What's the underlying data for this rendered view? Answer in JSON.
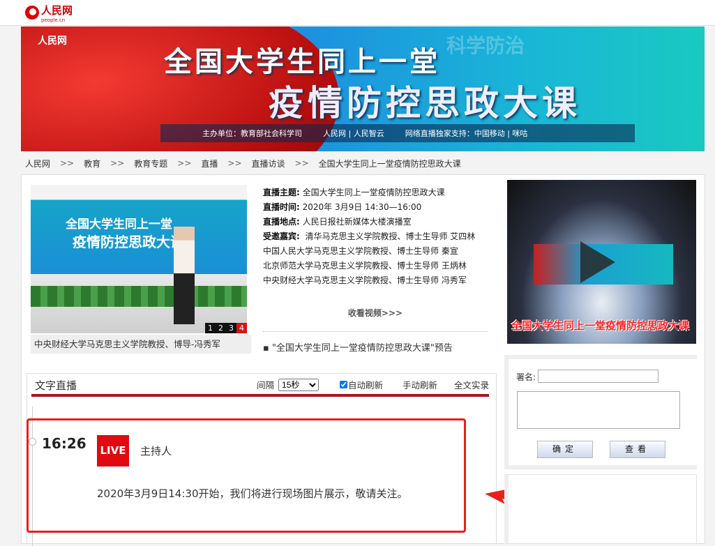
{
  "site": {
    "logo_text": "人民网",
    "logo_sub": "people.cn"
  },
  "banner": {
    "line1": "全国大学生同上一堂",
    "line2": "疫情防控思政大课",
    "bg_text": "科学防治",
    "sponsor": "主办单位：教育部社会科学司",
    "sponsor_logos": "人民网 | 人民智云",
    "support": "网络直播独家支持：中国移动 | 咪咕"
  },
  "breadcrumb": [
    "人民网",
    "教育",
    "教育专题",
    "直播",
    "直播访谈",
    "全国大学生同上一堂疫情防控思政大课"
  ],
  "breadcrumb_sep": ">>",
  "photo": {
    "title1": "全国大学生同上一堂",
    "title2": "疫情防控思政大课",
    "pages": [
      "1",
      "2",
      "3",
      "4"
    ],
    "active_page": 4,
    "caption": "中央财经大学马克思主义学院教授、博导-冯秀军"
  },
  "info": {
    "topic_label": "直播主题:",
    "topic": "全国大学生同上一堂疫情防控思政大课",
    "time_label": "直播时间:",
    "time": "2020年 3月9日 14:30—16:00",
    "place_label": "直播地点:",
    "place": "人民日报社新媒体大楼演播室",
    "guests_label": "受邀嘉宾:",
    "guests": [
      "清华马克思主义学院教授、博士生导师 艾四林",
      "中国人民大学马克思主义学院教授、博士生导师 秦宣",
      "北京师范大学马克思主义学院教授、博士生导师 王炳林",
      "中央财经大学马克思主义学院教授、博士生导师 冯秀军"
    ],
    "watch": "收看视频>>>",
    "preview": "\"全国大学生同上一堂疫情防控思政大课\"预告"
  },
  "video": {
    "overlay_title": "全国大学生同上一堂疫情防控思政大课"
  },
  "live": {
    "title": "文字直播",
    "interval_label": "间隔",
    "interval": "15秒",
    "auto_refresh": "自动刷新",
    "manual_refresh": "手动刷新",
    "full_text": "全文实录",
    "entries": [
      {
        "time": "16:26",
        "badge": "LIVE",
        "speaker": "主持人",
        "text": "2020年3月9日14:30开始，我们将进行现场图片展示，敬请关注。"
      }
    ]
  },
  "comment": {
    "sign_label": "署名:",
    "sign_value": "",
    "confirm": "确定",
    "view": "查看"
  },
  "colors": {
    "accent": "#a8161c",
    "live_badge": "#e10a10",
    "annotation": "#e8201a"
  }
}
